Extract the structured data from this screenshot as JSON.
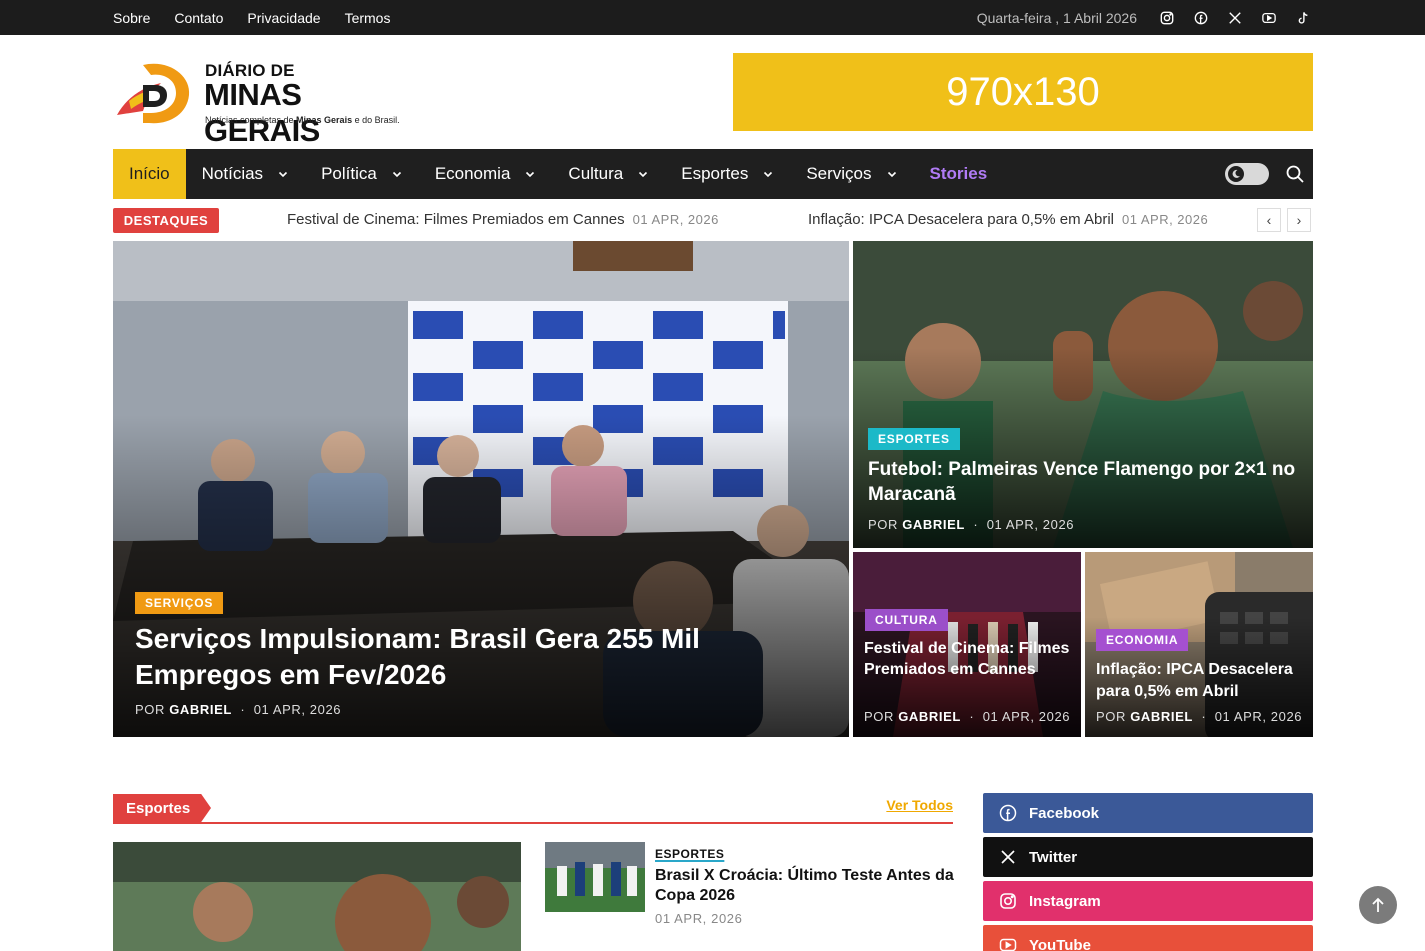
{
  "topbar": {
    "links": [
      "Sobre",
      "Contato",
      "Privacidade",
      "Termos"
    ],
    "date": "Quarta-feira , 1 Abril 2026",
    "social_icons": [
      "instagram-icon",
      "facebook-icon",
      "x-icon",
      "youtube-icon",
      "tiktok-icon"
    ]
  },
  "logo": {
    "line1": "DIÁRIO DE",
    "line2": "MINAS GERAIS",
    "tagline_a": "Notícias completas de ",
    "tagline_b": "Minas Gerais",
    "tagline_c": " e do Brasil."
  },
  "ad": {
    "label": "970x130"
  },
  "nav": {
    "items": [
      "Início",
      "Notícias",
      "Política",
      "Economia",
      "Cultura",
      "Esportes",
      "Serviços",
      "Stories"
    ]
  },
  "ticker": {
    "badge": "DESTAQUES",
    "entries": [
      {
        "title": "Festival de Cinema: Filmes Premiados em Cannes",
        "date": "01 APR, 2026"
      },
      {
        "title": "Inflação: IPCA Desacelera para 0,5% em Abril",
        "date": "01 APR, 2026"
      }
    ],
    "prev": "‹",
    "next": "›"
  },
  "hero": {
    "main": {
      "category": "SERVIÇOS",
      "title": "Serviços Impulsionam: Brasil Gera 255 Mil Empregos em Fev/2026",
      "by": "POR",
      "author": "GABRIEL",
      "date": "01 APR, 2026"
    },
    "top_right": {
      "category": "ESPORTES",
      "title": "Futebol: Palmeiras Vence Flamengo por 2×1 no Maracanã",
      "by": "POR",
      "author": "GABRIEL",
      "date": "01 APR, 2026"
    },
    "bottom_left": {
      "category": "CULTURA",
      "title": "Festival de Cinema: Filmes Premiados em Cannes",
      "by": "POR",
      "author": "GABRIEL",
      "date": "01 APR, 2026"
    },
    "bottom_right": {
      "category": "ECONOMIA",
      "title": "Inflação: IPCA Desacelera para 0,5% em Abril",
      "by": "POR",
      "author": "GABRIEL",
      "date": "01 APR, 2026"
    }
  },
  "sports": {
    "heading": "Esportes",
    "see_all": "Ver Todos",
    "list_item": {
      "category": "ESPORTES",
      "title": "Brasil X Croácia: Último Teste Antes da Copa 2026",
      "date": "01 APR, 2026"
    }
  },
  "social": {
    "facebook": "Facebook",
    "twitter": "Twitter",
    "instagram": "Instagram",
    "youtube": "YouTube"
  },
  "colors": {
    "accent_yellow": "#f0c019",
    "accent_red": "#e0413e",
    "nav_bg": "#1f1f1f",
    "servicos": "#f09a13",
    "esportes": "#1cb9c8",
    "cultura": "#9b4fc9",
    "economia": "#a550d0",
    "facebook": "#3b5998",
    "twitter": "#111111",
    "instagram": "#e1306c",
    "youtube": "#e8503a"
  }
}
